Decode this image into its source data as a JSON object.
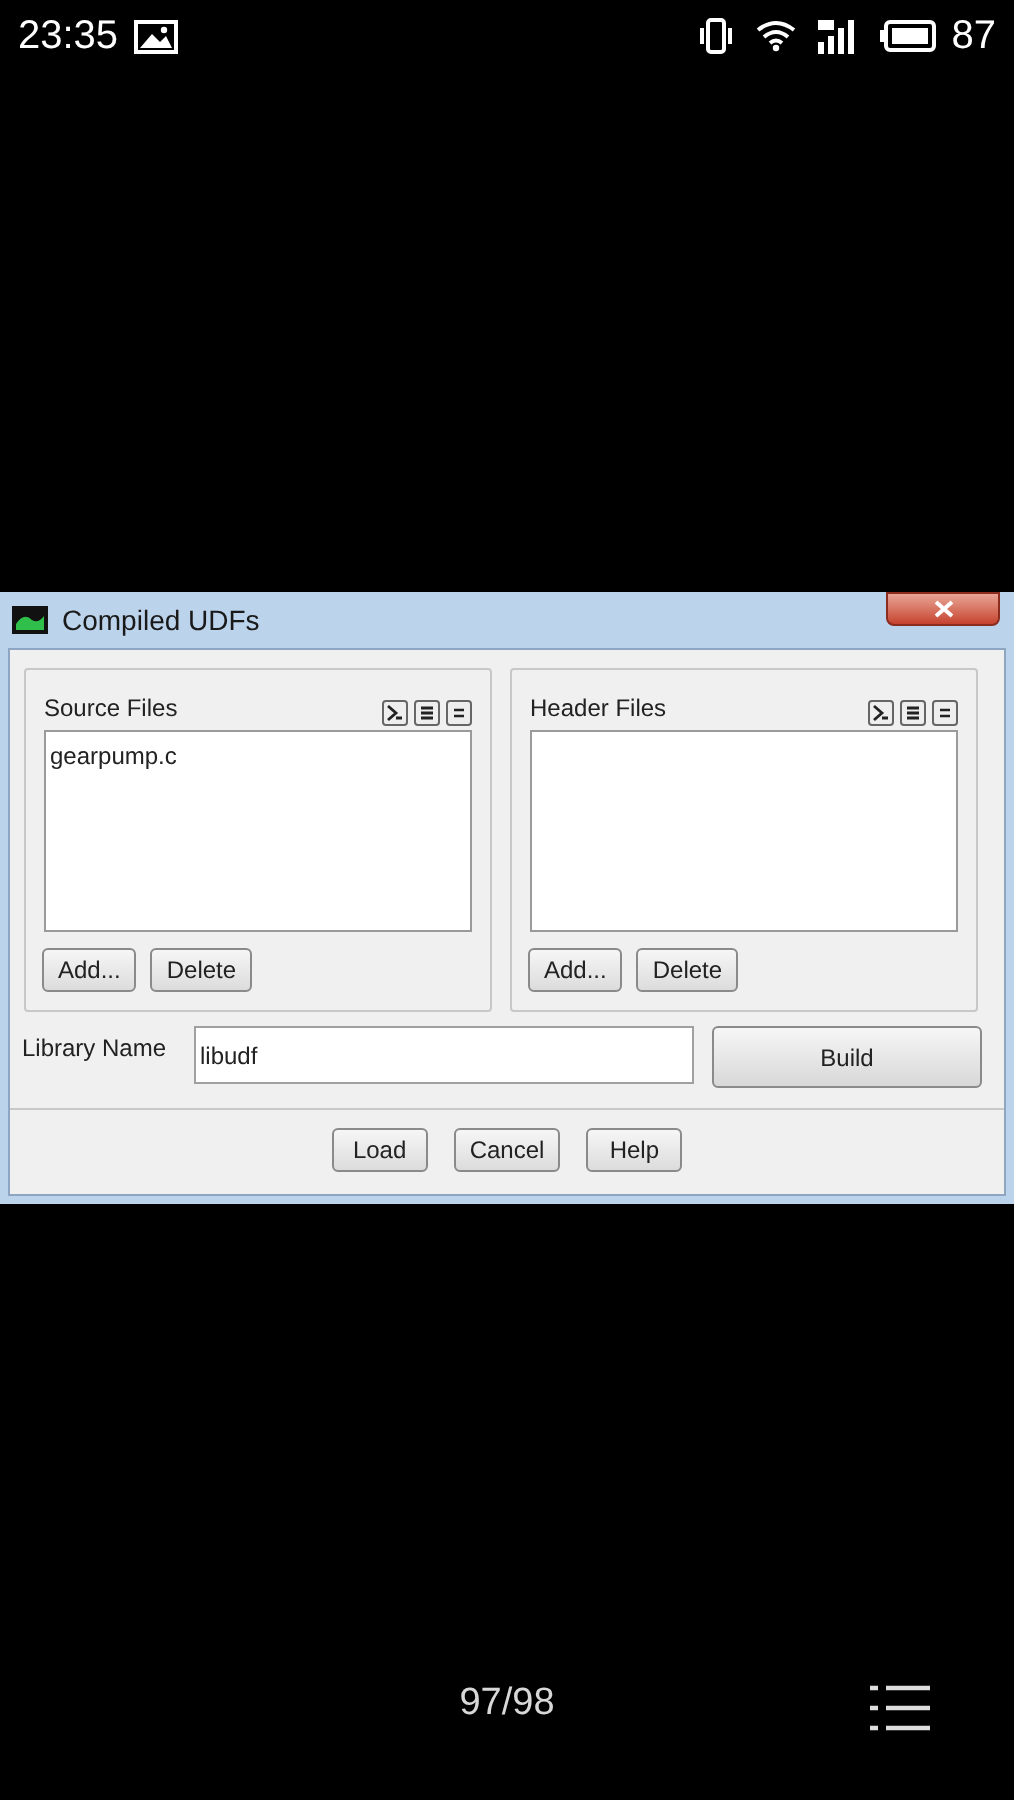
{
  "status_bar": {
    "time": "23:35",
    "battery": "87"
  },
  "window": {
    "title": "Compiled UDFs"
  },
  "groups": [
    {
      "title": "Source Files",
      "files": [
        "gearpump.c"
      ],
      "buttons": [
        "Add...",
        "Delete"
      ]
    },
    {
      "title": "Header Files",
      "buttons": [
        "Add...",
        "Delete"
      ]
    }
  ],
  "library": {
    "label": "Library Name",
    "value": "libudf"
  },
  "build_button": "Build",
  "buttons": [
    "Load",
    "Cancel",
    "Help"
  ],
  "viewer": {
    "page": "97/98"
  }
}
